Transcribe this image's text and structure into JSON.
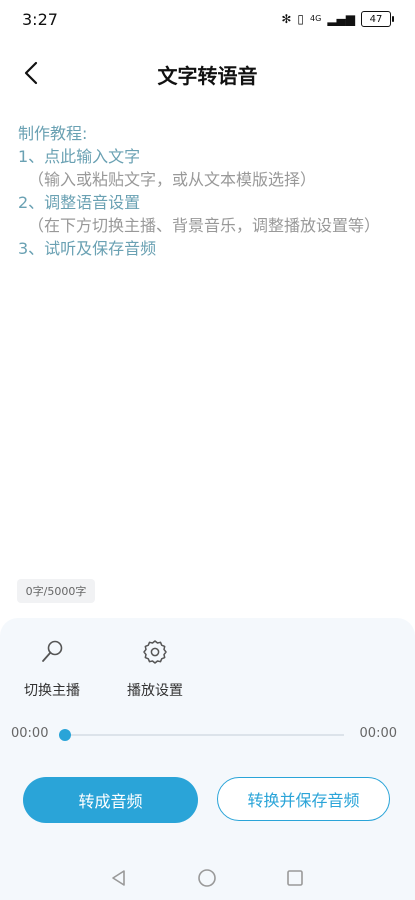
{
  "status": {
    "time": "3:27",
    "battery": "47",
    "network": "4G"
  },
  "header": {
    "title": "文字转语音"
  },
  "tutorial": {
    "heading": "制作教程:",
    "step1": "1、点此输入文字",
    "step1_sub": "（输入或粘贴文字，或从文本模版选择）",
    "step2": "2、调整语音设置",
    "step2_sub": "（在下方切换主播、背景音乐，调整播放设置等）",
    "step3": "3、试听及保存音频"
  },
  "char_count": "0字/5000字",
  "tools": {
    "switch_anchor": "切换主播",
    "playback_settings": "播放设置"
  },
  "player": {
    "current_time": "00:00",
    "total_time": "00:00",
    "progress": 0
  },
  "actions": {
    "convert": "转成音频",
    "convert_save": "转换并保存音频"
  },
  "colors": {
    "accent": "#2aa4d8",
    "tutorial_text": "#6aa1b3",
    "panel_bg": "#f4f8fc"
  }
}
